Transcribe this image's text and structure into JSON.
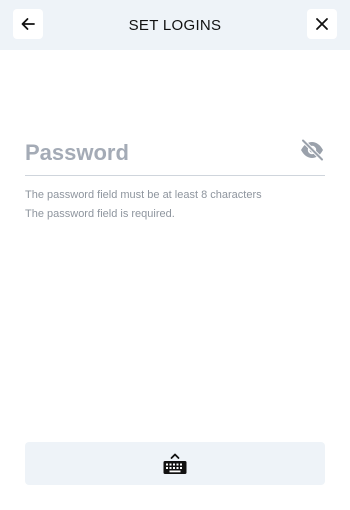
{
  "header": {
    "title": "SET LOGINS",
    "back_icon": "arrow-left-icon",
    "close_icon": "close-icon"
  },
  "password": {
    "placeholder": "Password",
    "value": "",
    "visibility_icon": "eye-off-icon"
  },
  "errors": [
    "The password field must be at least 8 characters",
    "The password field is required."
  ],
  "keyboard_bar": {
    "icon": "keyboard-show-icon"
  },
  "colors": {
    "header_bg": "#eef3f8",
    "placeholder": "#a4abb6",
    "error_text": "#8e959e"
  }
}
